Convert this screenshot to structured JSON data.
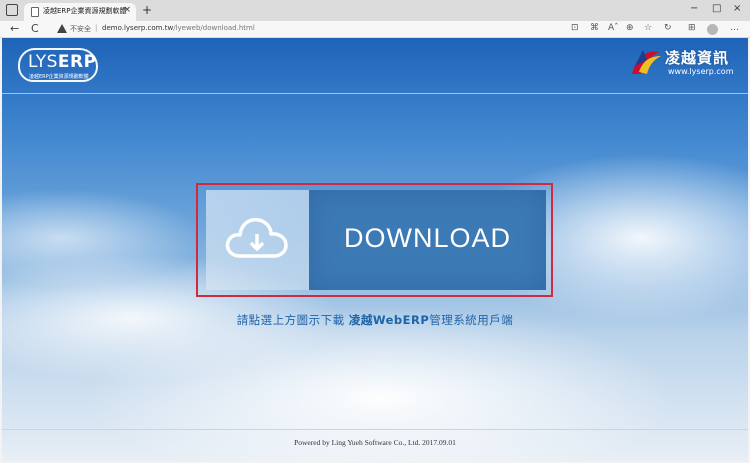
{
  "browser": {
    "tab_title": "凌越ERP企業資源規劃軟體",
    "tab_close": "×",
    "new_tab": "+",
    "minimize": "−",
    "maximize": "□",
    "close": "×",
    "back": "←",
    "refresh": "C",
    "insecure_label": "不安全",
    "separator": "|",
    "url_host": "demo.lyserp.com.tw",
    "url_path": "/lyeweb/download.html",
    "tools": [
      "⊡",
      "⌘",
      "Aˆ",
      "⊕",
      "☆",
      "↻",
      "☆",
      "⊞",
      "…"
    ]
  },
  "header": {
    "logo_text_light": "LYS",
    "logo_text_bold": "ERP",
    "logo_subtitle": "凌越ERP企業資源規劃軟體",
    "brand_name": "凌越資訊",
    "brand_url": "www.lyserp.com"
  },
  "download": {
    "label": "DOWNLOAD"
  },
  "hint": {
    "text_plain": "請點選上方圖示下載 ",
    "text_bold": "凌越WebERP",
    "text_tail": "管理系統用戶端"
  },
  "footer": {
    "text": "Powered by Ling Yueh Software Co., Ltd. 2017.09.01"
  },
  "colors": {
    "highlight": "#d12a3c",
    "download_pane": "#3c7ab6",
    "hint": "#1f63a8"
  }
}
